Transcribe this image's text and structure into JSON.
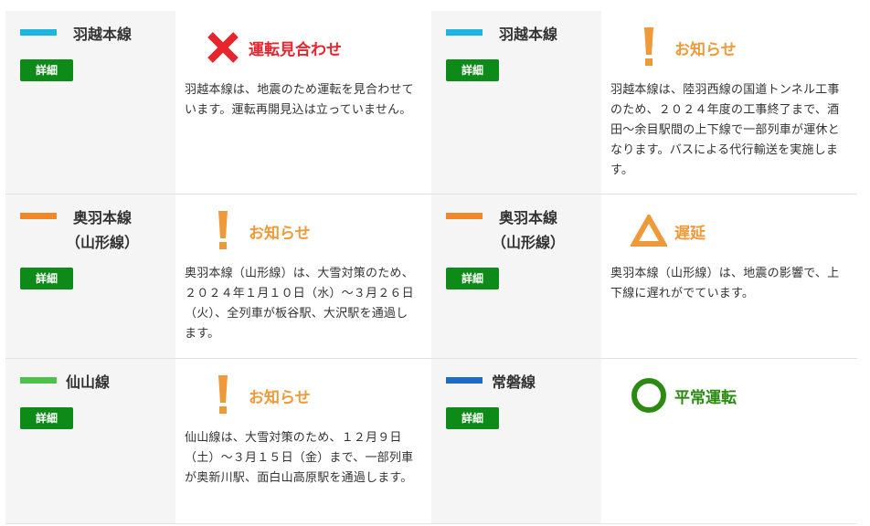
{
  "colors": {
    "detail_button": "#0d8a17",
    "suspended": "#e8242c",
    "notice": "#ee9a3a",
    "normal": "#2b8a12",
    "uetsu": "#1cb4e0",
    "ou": "#f0882a",
    "senzan": "#4cc24c",
    "joban": "#1b6bc7"
  },
  "routes": [
    {
      "name": "羽越本線",
      "line_color": "#1cb4e0",
      "detail_label": "詳細",
      "status": {
        "icon": "x-icon",
        "label": "運転見合わせ",
        "color": "#e8242c"
      },
      "description": "羽越本線は、地震のため運転を見合わせています。運転再開見込は立っていません。"
    },
    {
      "name": "羽越本線",
      "line_color": "#1cb4e0",
      "detail_label": "詳細",
      "status": {
        "icon": "exclamation-icon",
        "label": "お知らせ",
        "color": "#ee9a3a"
      },
      "description": "羽越本線は、陸羽西線の国道トンネル工事のため、２０２４年度の工事終了まで、酒田～余目駅間の上下線で一部列車が運休となります。バスによる代行輸送を実施します。"
    },
    {
      "name": "奥羽本線（山形線）",
      "line_color": "#f0882a",
      "detail_label": "詳細",
      "status": {
        "icon": "exclamation-icon",
        "label": "お知らせ",
        "color": "#ee9a3a"
      },
      "description": "奥羽本線（山形線）は、大雪対策のため、２０２４年１月１０日（水）～３月２６日（火）、全列車が板谷駅、大沢駅を通過します。"
    },
    {
      "name": "奥羽本線（山形線）",
      "line_color": "#f0882a",
      "detail_label": "詳細",
      "status": {
        "icon": "triangle-icon",
        "label": "遅延",
        "color": "#ee9a3a"
      },
      "description": "奥羽本線（山形線）は、地震の影響で、上下線に遅れがでています。"
    },
    {
      "name": "仙山線",
      "line_color": "#4cc24c",
      "detail_label": "詳細",
      "status": {
        "icon": "exclamation-icon",
        "label": "お知らせ",
        "color": "#ee9a3a"
      },
      "description": "仙山線は、大雪対策のため、１２月９日（土）～３月１５日（金）まで、一部列車が奥新川駅、面白山高原駅を通過します。"
    },
    {
      "name": "常磐線",
      "line_color": "#1b6bc7",
      "detail_label": "詳細",
      "status": {
        "icon": "circle-icon",
        "label": "平常運転",
        "color": "#2b8a12"
      },
      "description": ""
    }
  ]
}
